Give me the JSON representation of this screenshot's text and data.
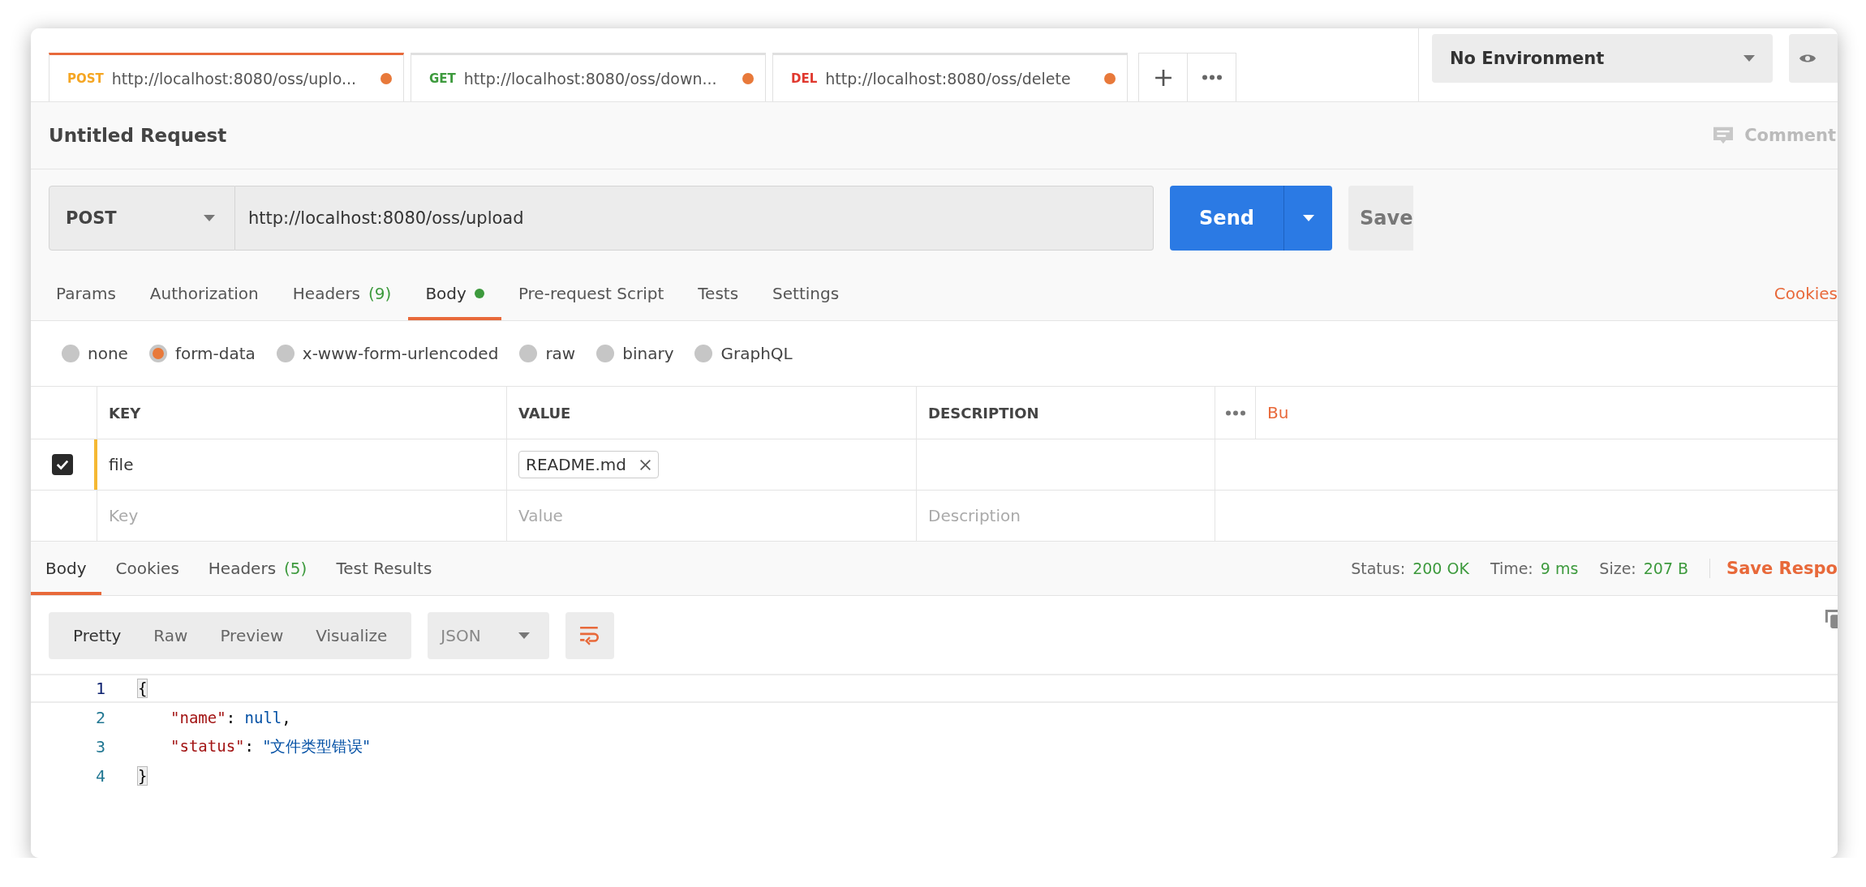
{
  "request_tabs_bar": [
    {
      "method": "POST",
      "color": "#f5a623",
      "url": "http://localhost:8080/oss/uplo...",
      "unsaved": true,
      "selected": true
    },
    {
      "method": "GET",
      "color": "#3d9a3d",
      "url": "http://localhost:8080/oss/down...",
      "unsaved": true,
      "selected": false
    },
    {
      "method": "DEL",
      "color": "#e0382e",
      "url": "http://localhost:8080/oss/delete",
      "unsaved": true,
      "selected": false
    }
  ],
  "environment": {
    "value": "No Environment"
  },
  "request": {
    "title": "Untitled Request",
    "comments": "Comment"
  },
  "url_bar": {
    "method": "POST",
    "url": "http://localhost:8080/oss/upload",
    "send": "Send",
    "save": "Save"
  },
  "request_tabs": [
    {
      "label": "Params",
      "selected": false
    },
    {
      "label": "Authorization",
      "selected": false
    },
    {
      "label": "Headers",
      "count": "(9)",
      "selected": false
    },
    {
      "label": "Body",
      "has_content": true,
      "selected": true
    },
    {
      "label": "Pre-request Script",
      "selected": false
    },
    {
      "label": "Tests",
      "selected": false
    },
    {
      "label": "Settings",
      "selected": false
    }
  ],
  "cookies_link": "Cookies",
  "body_types": [
    {
      "label": "none",
      "selected": false
    },
    {
      "label": "form-data",
      "selected": true
    },
    {
      "label": "x-www-form-urlencoded",
      "selected": false
    },
    {
      "label": "raw",
      "selected": false
    },
    {
      "label": "binary",
      "selected": false
    },
    {
      "label": "GraphQL",
      "selected": false
    }
  ],
  "params_table": {
    "columns": [
      "KEY",
      "VALUE",
      "DESCRIPTION"
    ],
    "bulk_edit": "Bu",
    "rows": [
      {
        "checked": true,
        "key": "file",
        "file": "README.md"
      }
    ],
    "placeholder_row": {
      "key": "Key",
      "value": "Value",
      "description": "Description"
    }
  },
  "response": {
    "tabs": [
      {
        "label": "Body",
        "selected": true
      },
      {
        "label": "Cookies",
        "selected": false
      },
      {
        "label": "Headers",
        "count": "(5)",
        "selected": false
      },
      {
        "label": "Test Results",
        "selected": false
      }
    ],
    "status_label": "Status:",
    "status": "200 OK",
    "time_label": "Time:",
    "time": "9 ms",
    "size_label": "Size:",
    "size": "207 B",
    "save_response": "Save Respo",
    "view_modes": [
      {
        "label": "Pretty",
        "selected": true
      },
      {
        "label": "Raw",
        "selected": false
      },
      {
        "label": "Preview",
        "selected": false
      },
      {
        "label": "Visualize",
        "selected": false
      }
    ],
    "format": "JSON",
    "code_lines": [
      {
        "number": "1",
        "active": true,
        "indented": false,
        "tokens": [
          {
            "kind": "bracket",
            "text": "{"
          }
        ]
      },
      {
        "number": "2",
        "active": false,
        "indented": true,
        "tokens": [
          {
            "kind": "key",
            "text": "\"name\""
          },
          {
            "kind": "punct",
            "text": ": "
          },
          {
            "kind": "literal",
            "text": "null"
          },
          {
            "kind": "punct",
            "text": ","
          }
        ]
      },
      {
        "number": "3",
        "active": false,
        "indented": true,
        "tokens": [
          {
            "kind": "key",
            "text": "\"status\""
          },
          {
            "kind": "punct",
            "text": ": "
          },
          {
            "kind": "string",
            "text": "\"文件类型错误\""
          }
        ]
      },
      {
        "number": "4",
        "active": false,
        "indented": false,
        "tokens": [
          {
            "kind": "bracket",
            "text": "}"
          }
        ]
      }
    ]
  }
}
